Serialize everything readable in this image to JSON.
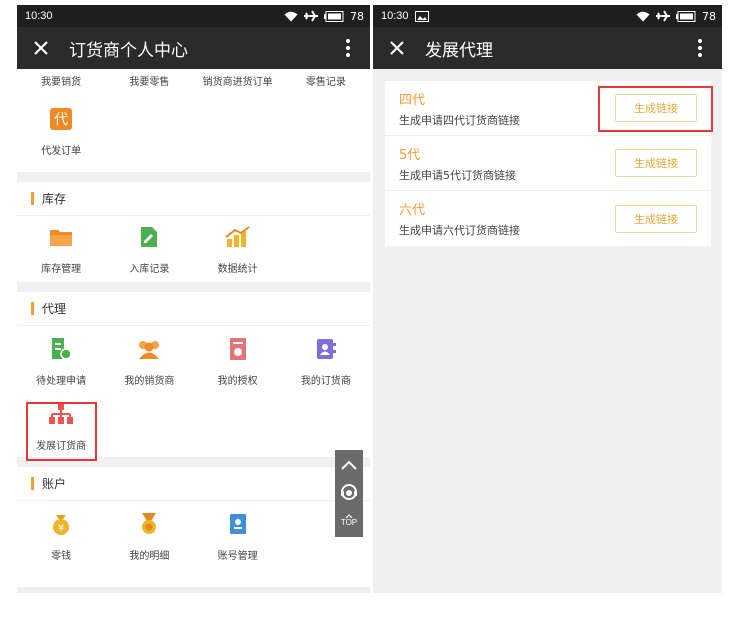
{
  "left_screen": {
    "status": {
      "time": "10:30",
      "battery": "78"
    },
    "title": "订货商个人中心",
    "top_row": [
      "我要销货",
      "我要零售",
      "销货商进货订单",
      "零售记录"
    ],
    "proxy_order": {
      "label": "代发订单",
      "icon_char": "代"
    },
    "inventory": {
      "title": "库存",
      "items": [
        "库存管理",
        "入库记录",
        "数据统计"
      ]
    },
    "agent": {
      "title": "代理",
      "items": [
        "待处理申请",
        "我的销货商",
        "我的授权",
        "我的订货商",
        "发展订货商"
      ]
    },
    "account": {
      "title": "账户",
      "items": [
        "零钱",
        "我的明细",
        "账号管理"
      ]
    },
    "float_top_label": "TOP"
  },
  "right_screen": {
    "status": {
      "time": "10:30",
      "battery": "78"
    },
    "title": "发展代理",
    "rows": [
      {
        "name": "四代",
        "desc": "生成申请四代订货商链接",
        "button": "生成链接"
      },
      {
        "name": "5代",
        "desc": "生成申请5代订货商链接",
        "button": "生成链接"
      },
      {
        "name": "六代",
        "desc": "生成申请六代订货商链接",
        "button": "生成链接"
      }
    ]
  },
  "colors": {
    "accent_orange": "#f39c34",
    "highlight_red": "#e53935",
    "icon_green": "#4caf50",
    "icon_pink": "#e57373",
    "icon_purple": "#7e6fd6",
    "icon_blue": "#3f8fd9"
  },
  "icons": {
    "inventory": [
      "folder-icon",
      "document-edit-icon",
      "chart-icon"
    ],
    "agent": [
      "pending-doc-icon",
      "users-icon",
      "certificate-icon",
      "contacts-icon",
      "org-chart-icon"
    ],
    "account": [
      "coin-icon",
      "medal-icon",
      "account-book-icon"
    ]
  }
}
